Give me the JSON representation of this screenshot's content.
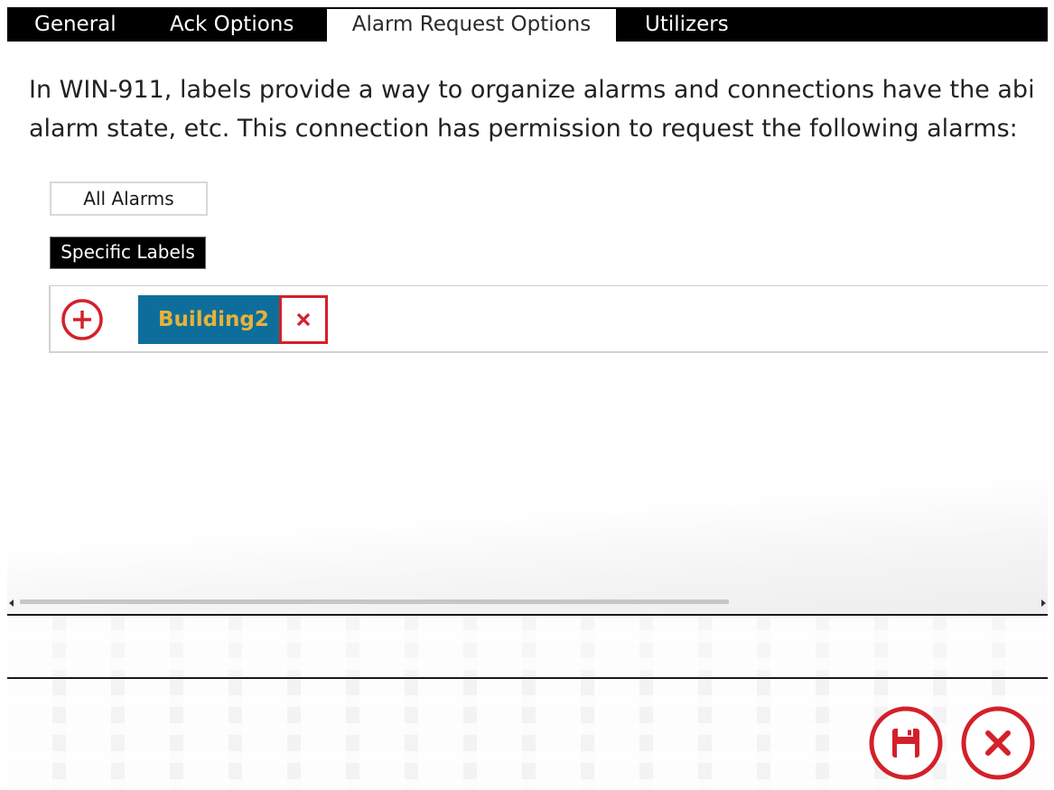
{
  "tabs": [
    {
      "label": "General"
    },
    {
      "label": "Ack Options"
    },
    {
      "label": "Alarm Request Options",
      "active": true
    },
    {
      "label": "Utilizers"
    }
  ],
  "description": {
    "line1": "In WIN-911, labels provide a way to organize alarms and connections have the abi",
    "line2": "alarm state, etc. This connection has permission to request the following alarms:"
  },
  "options": {
    "all_alarms": "All Alarms",
    "specific_labels": "Specific Labels",
    "selected": "Specific Labels"
  },
  "labels": [
    {
      "name": "Building2"
    }
  ],
  "scrollbar": {
    "horizontal_thumb_fraction": 0.68
  },
  "icons": {
    "add": "plus-circle-icon",
    "remove": "close-icon",
    "save": "save-floppy-icon",
    "cancel": "cancel-circle-icon"
  },
  "colors": {
    "accent_red": "#d4202a",
    "label_bg": "#0e6e9b",
    "label_text": "#e6b23a",
    "tabbar_bg": "#000000"
  }
}
